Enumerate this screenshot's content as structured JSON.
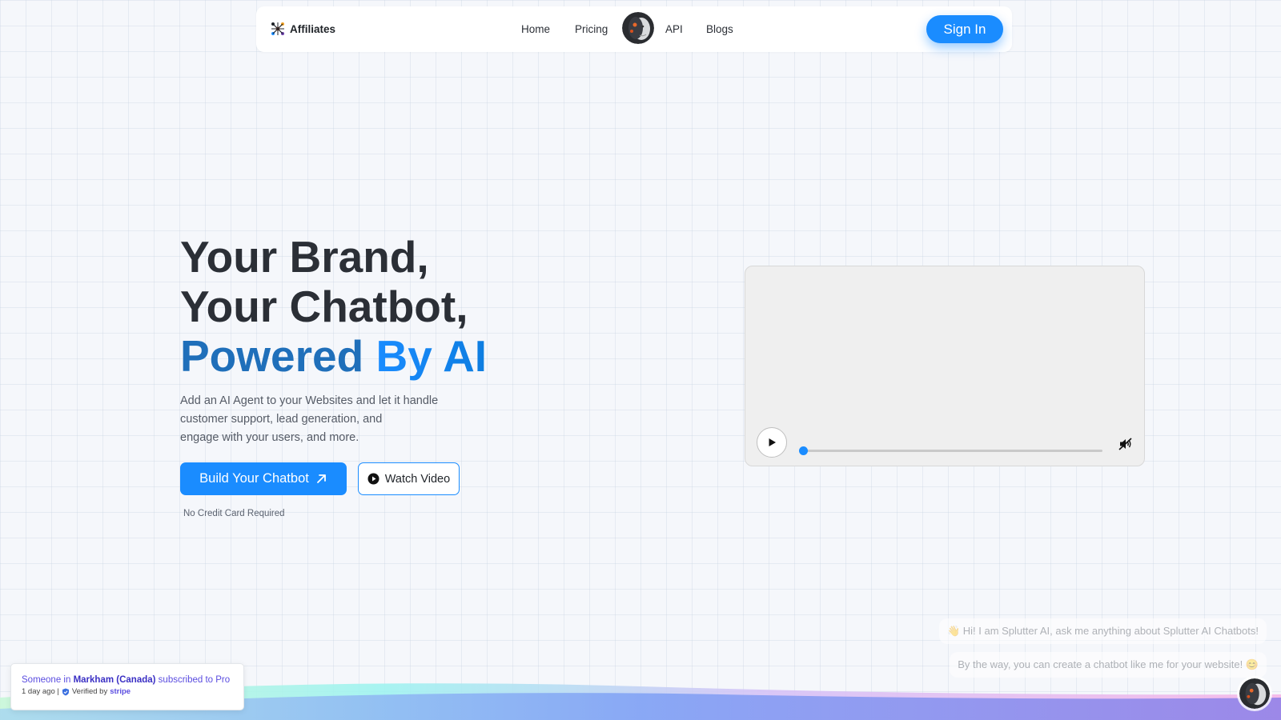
{
  "nav": {
    "brand_label": "Affiliates",
    "links": [
      "Home",
      "Pricing",
      "API",
      "Blogs"
    ],
    "signin_label": "Sign In"
  },
  "hero": {
    "title_line1": "Your Brand,",
    "title_line2": "Your Chatbot,",
    "title_line3_a": "Powered",
    "title_line3_b": "By AI",
    "description_lines": [
      "Add an AI Agent to your Websites and let it handle",
      "customer support, lead generation, and",
      "engage with your users, and more."
    ],
    "build_button_label": "Build Your Chatbot",
    "watch_button_label": "Watch Video",
    "no_credit_card": "No Credit Card Required"
  },
  "video": {
    "progress": 0
  },
  "chat": {
    "bubble1": "👋 Hi! I am Splutter AI, ask me anything about Splutter AI Chatbots!",
    "bubble2": "By the way, you can create a chatbot like me for your website! 😊"
  },
  "toast": {
    "prefix": "Someone in",
    "location": "Markham (Canada)",
    "action": "subscribed to Pro",
    "time": "1 day ago |",
    "verified": "Verified by",
    "stripe": "stripe"
  },
  "colors": {
    "accent": "#1a8cff",
    "text": "#2b2f36",
    "powered": "#1f6fba"
  }
}
